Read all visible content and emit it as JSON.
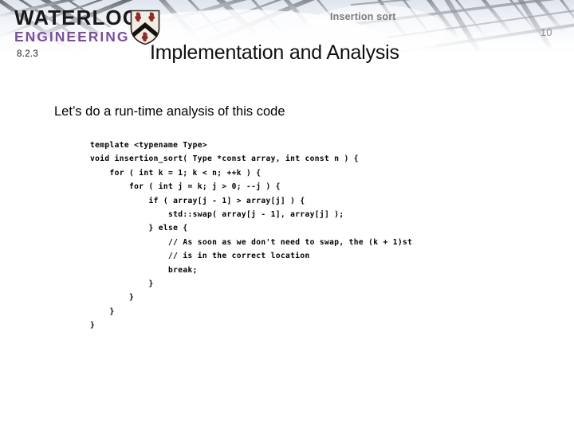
{
  "slide": {
    "section_number": "8.2.3",
    "topic_label": "Insertion sort",
    "page_number": "10",
    "title": "Implementation and Analysis",
    "lead_line": "Let’s do a run-time analysis of this code"
  },
  "logo": {
    "wordmark": "WATERLOO",
    "subword": "ENGINEERING",
    "crest_name": "waterloo-shield-crest",
    "wordmark_color": "#191919",
    "subword_color": "#7b4fa0"
  },
  "code": {
    "language": "cpp",
    "lines": [
      "template <typename Type>",
      "void insertion_sort( Type *const array, int const n ) {",
      "    for ( int k = 1; k < n; ++k ) {",
      "        for ( int j = k; j > 0; --j ) {",
      "            if ( array[j - 1] > array[j] ) {",
      "                std::swap( array[j - 1], array[j] );",
      "            } else {",
      "                // As soon as we don't need to swap, the (k + 1)st",
      "                // is in the correct location",
      "                break;",
      "            }",
      "        }",
      "    }",
      "}"
    ]
  },
  "colors": {
    "background": "#ffffff",
    "text": "#000000",
    "muted_text": "#7c7c80",
    "accent_purple": "#7b4fa0",
    "crest_red": "#8c2f2a"
  }
}
